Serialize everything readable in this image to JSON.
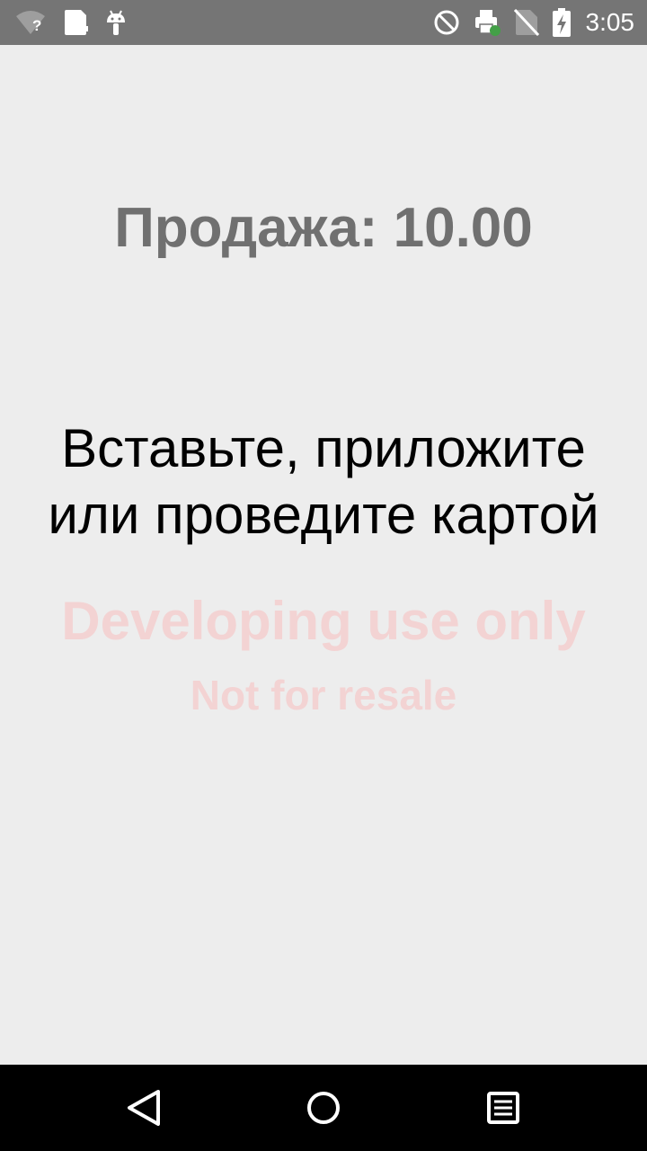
{
  "status_bar": {
    "time": "3:05",
    "wifi_badge": "?",
    "icons_left": [
      "wifi-unknown-icon",
      "sim-card-icon",
      "android-icon"
    ],
    "icons_right": [
      "do-not-disturb-icon",
      "printer-icon",
      "no-sim-icon",
      "battery-charging-icon"
    ]
  },
  "main": {
    "sale_title": "Продажа: 10.00",
    "prompt_line_1": "Вставьте, приложите",
    "prompt_line_2": "или проведите картой",
    "watermark_line_1": "Developing use only",
    "watermark_line_2": "Not for resale"
  },
  "nav_bar": {
    "buttons": [
      "back-icon",
      "home-icon",
      "recents-icon"
    ]
  },
  "colors": {
    "status_bar": "#757575",
    "background": "#ededed",
    "title": "#707070",
    "watermark": "#f3d3d3",
    "nav_bar": "#000000",
    "printer_badge": "#43a047"
  }
}
